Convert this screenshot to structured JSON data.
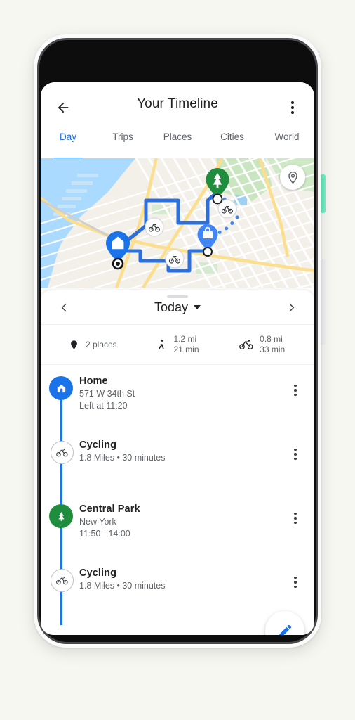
{
  "app": {
    "title": "Your Timeline",
    "back_icon": "arrow-left-icon",
    "overflow_icon": "more-vert-icon"
  },
  "tabs": [
    {
      "label": "Day",
      "active": true
    },
    {
      "label": "Trips",
      "active": false
    },
    {
      "label": "Places",
      "active": false
    },
    {
      "label": "Cities",
      "active": false
    },
    {
      "label": "World",
      "active": false
    }
  ],
  "map": {
    "pin_button_icon": "map-pin-outline-icon",
    "markers": [
      {
        "name": "home-marker",
        "icon": "house-icon",
        "color": "#1a73e8"
      },
      {
        "name": "park-marker",
        "icon": "tree-icon",
        "color": "#1e8e3e"
      },
      {
        "name": "work-marker",
        "icon": "bag-icon",
        "color": "#4285f4"
      },
      {
        "name": "cycling-marker-1",
        "icon": "bicycle-icon",
        "color": "#ffffff"
      },
      {
        "name": "cycling-marker-2",
        "icon": "bicycle-icon",
        "color": "#ffffff"
      },
      {
        "name": "cycling-marker-3",
        "icon": "bicycle-icon",
        "color": "#ffffff"
      }
    ],
    "route_color": "#2d6fdb"
  },
  "daynav": {
    "prev_icon": "chevron-left-icon",
    "next_icon": "chevron-right-icon",
    "label": "Today",
    "caret_icon": "caret-down-icon"
  },
  "stats": [
    {
      "icon": "place-pin-icon",
      "line1": "2 places",
      "line2": ""
    },
    {
      "icon": "walking-icon",
      "line1": "1.2 mi",
      "line2": "21 min"
    },
    {
      "icon": "bicycle-icon",
      "line1": "0.8 mi",
      "line2": "33 min"
    }
  ],
  "timeline": [
    {
      "kind": "place-home",
      "icon": "house-icon",
      "title": "Home",
      "sub1": "571 W 34th St",
      "sub2": "Left at 11:20",
      "menu_icon": "more-vert-icon"
    },
    {
      "kind": "activity",
      "icon": "bicycle-icon",
      "title": "Cycling",
      "sub1": "1.8 Miles • 30 minutes",
      "sub2": "",
      "menu_icon": "more-vert-icon"
    },
    {
      "kind": "place-park",
      "icon": "tree-icon",
      "title": "Central Park",
      "sub1": "New York",
      "sub2": "11:50 - 14:00",
      "menu_icon": "more-vert-icon"
    },
    {
      "kind": "activity",
      "icon": "bicycle-icon",
      "title": "Cycling",
      "sub1": "1.8 Miles • 30 minutes",
      "sub2": "",
      "menu_icon": "more-vert-icon"
    }
  ],
  "fab": {
    "icon": "pencil-edit-icon",
    "color": "#1a73e8"
  },
  "colors": {
    "accent": "#1a73e8",
    "green": "#1e8e3e",
    "text_primary": "#202124",
    "text_secondary": "#5f6368",
    "power_button": "#5fdfb0",
    "page_background": "#f7f7f2"
  }
}
